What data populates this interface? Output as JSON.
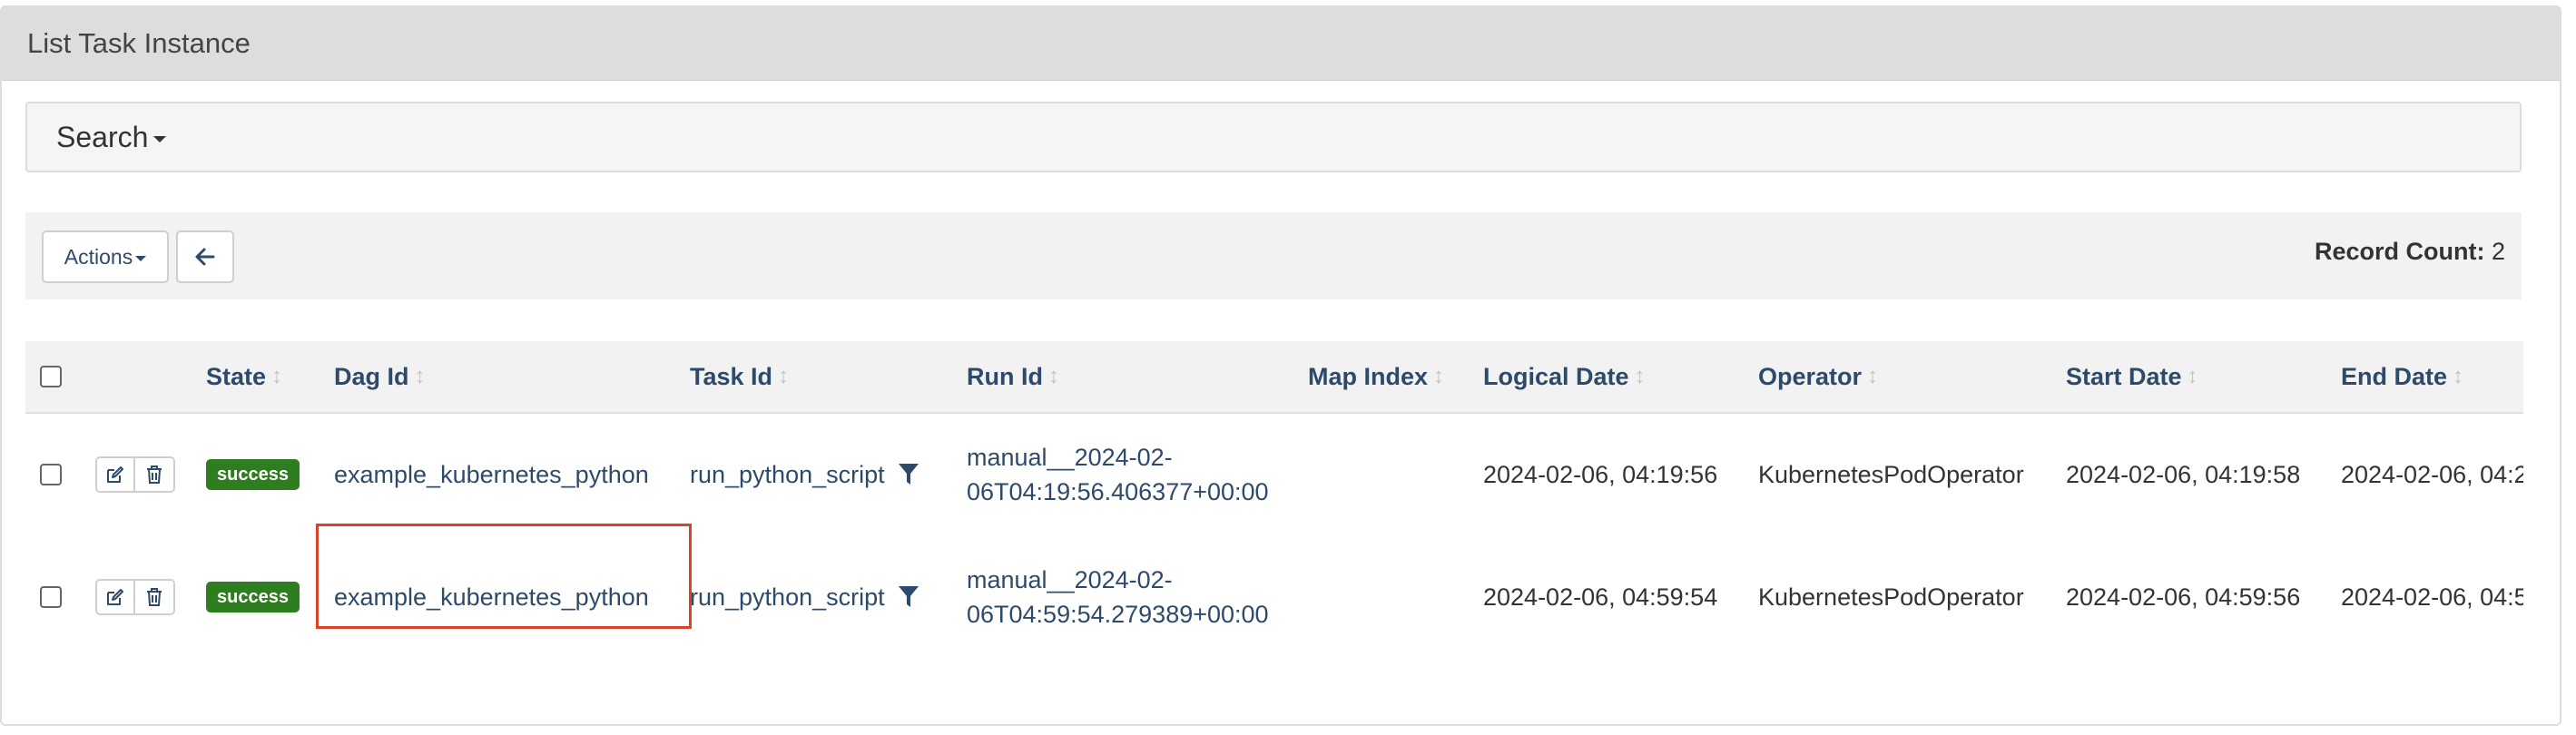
{
  "panel": {
    "title": "List Task Instance"
  },
  "search": {
    "label": "Search"
  },
  "toolbar": {
    "actions_label": "Actions",
    "record_count_label": "Record Count:",
    "record_count_value": "2"
  },
  "table": {
    "columns": [
      "State",
      "Dag Id",
      "Task Id",
      "Run Id",
      "Map Index",
      "Logical Date",
      "Operator",
      "Start Date",
      "End Date"
    ],
    "rows": [
      {
        "state": "success",
        "dag_id": "example_kubernetes_python",
        "task_id": "run_python_script",
        "run_id": "manual__2024-02-06T04:19:56.406377+00:00",
        "map_index": "",
        "logical_date": "2024-02-06, 04:19:56",
        "operator": "KubernetesPodOperator",
        "start_date": "2024-02-06, 04:19:58",
        "end_date": "2024-02-06, 04:2"
      },
      {
        "state": "success",
        "dag_id": "example_kubernetes_python",
        "task_id": "run_python_script",
        "run_id": "manual__2024-02-06T04:59:54.279389+00:00",
        "map_index": "",
        "logical_date": "2024-02-06, 04:59:54",
        "operator": "KubernetesPodOperator",
        "start_date": "2024-02-06, 04:59:56",
        "end_date": "2024-02-06, 04:5"
      }
    ]
  },
  "colors": {
    "link": "#2e4a6b",
    "success": "#2e7d1e",
    "highlight": "#d9432b",
    "heading_bg": "#dddddd"
  },
  "icons": {
    "back": "arrow-left-icon",
    "edit": "edit-icon",
    "delete": "trash-icon",
    "filter": "filter-icon",
    "sort": "sort-icon"
  }
}
